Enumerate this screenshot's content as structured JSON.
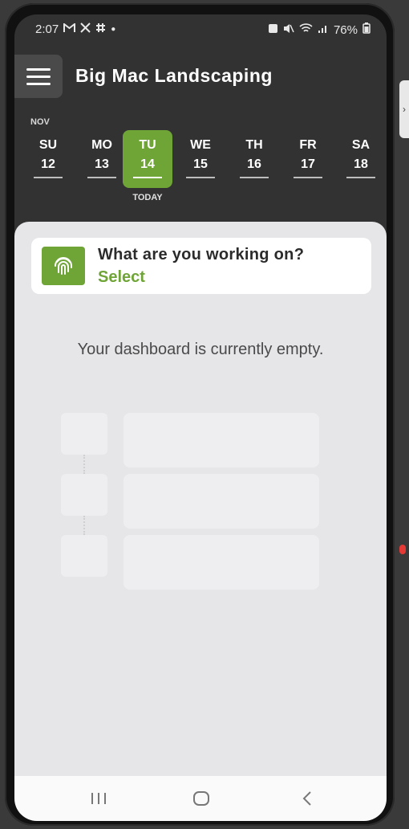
{
  "status_bar": {
    "time": "2:07",
    "notification_icons": [
      "mail-icon",
      "x-icon",
      "slack-icon"
    ],
    "battery": "76%"
  },
  "header": {
    "title": "Big Mac Landscaping",
    "menu_icon": "hamburger-icon"
  },
  "calendar": {
    "month": "NOV",
    "days": [
      {
        "name": "SU",
        "num": "12"
      },
      {
        "name": "MO",
        "num": "13"
      },
      {
        "name": "TU",
        "num": "14"
      },
      {
        "name": "WE",
        "num": "15"
      },
      {
        "name": "TH",
        "num": "16"
      },
      {
        "name": "FR",
        "num": "17"
      },
      {
        "name": "SA",
        "num": "18"
      }
    ],
    "selected_index": 2,
    "today_label": "TODAY"
  },
  "prompt": {
    "question": "What are you working on?",
    "action": "Select",
    "icon": "fingerprint-icon"
  },
  "dashboard": {
    "empty_message": "Your dashboard is currently empty."
  },
  "colors": {
    "accent": "#6fa437",
    "dark_bg": "#323232",
    "content_bg": "#e6e6e9"
  }
}
